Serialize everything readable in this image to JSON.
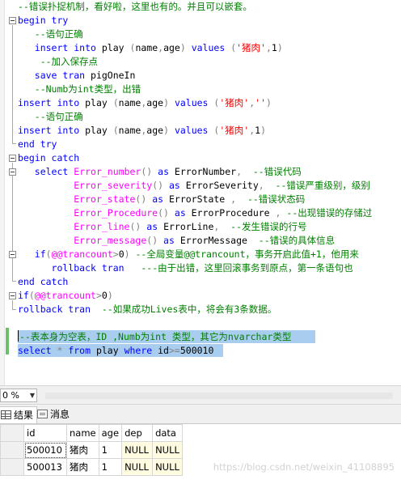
{
  "editor": {
    "lines": [
      [
        {
          "t": "--错误扑捉机制，看好啦，这里也有的。并且可以嵌套。",
          "c": "cm"
        }
      ],
      [
        {
          "t": "begin try",
          "c": "kw"
        }
      ],
      [
        {
          "t": "   --语句正确",
          "c": "cm"
        }
      ],
      [
        {
          "t": "   ",
          "c": ""
        },
        {
          "t": "insert into",
          "c": "kw"
        },
        {
          "t": " play ",
          "c": ""
        },
        {
          "t": "(",
          "c": "gy"
        },
        {
          "t": "name",
          "c": ""
        },
        {
          "t": ",",
          "c": "gy"
        },
        {
          "t": "age",
          "c": ""
        },
        {
          "t": ")",
          "c": "gy"
        },
        {
          "t": " values ",
          "c": "kw"
        },
        {
          "t": "(",
          "c": "gy"
        },
        {
          "t": "'猪肉'",
          "c": "st"
        },
        {
          "t": ",",
          "c": "gy"
        },
        {
          "t": "1",
          "c": ""
        },
        {
          "t": ")",
          "c": "gy"
        }
      ],
      [
        {
          "t": "    --加入保存点",
          "c": "cm"
        }
      ],
      [
        {
          "t": "   ",
          "c": ""
        },
        {
          "t": "save tran",
          "c": "kw"
        },
        {
          "t": " pigOneIn",
          "c": ""
        }
      ],
      [
        {
          "t": "   --Numb为int类型，出错",
          "c": "cm"
        }
      ],
      [
        {
          "t": "insert into",
          "c": "kw"
        },
        {
          "t": " play ",
          "c": ""
        },
        {
          "t": "(",
          "c": "gy"
        },
        {
          "t": "name",
          "c": ""
        },
        {
          "t": ",",
          "c": "gy"
        },
        {
          "t": "age",
          "c": ""
        },
        {
          "t": ")",
          "c": "gy"
        },
        {
          "t": " values ",
          "c": "kw"
        },
        {
          "t": "(",
          "c": "gy"
        },
        {
          "t": "'猪肉'",
          "c": "st"
        },
        {
          "t": ",",
          "c": "gy"
        },
        {
          "t": "''",
          "c": "st"
        },
        {
          "t": ")",
          "c": "gy"
        }
      ],
      [
        {
          "t": "   --语句正确",
          "c": "cm"
        }
      ],
      [
        {
          "t": "insert into",
          "c": "kw"
        },
        {
          "t": " play ",
          "c": ""
        },
        {
          "t": "(",
          "c": "gy"
        },
        {
          "t": "name",
          "c": ""
        },
        {
          "t": ",",
          "c": "gy"
        },
        {
          "t": "age",
          "c": ""
        },
        {
          "t": ")",
          "c": "gy"
        },
        {
          "t": " values ",
          "c": "kw"
        },
        {
          "t": "(",
          "c": "gy"
        },
        {
          "t": "'猪肉'",
          "c": "st"
        },
        {
          "t": ",",
          "c": "gy"
        },
        {
          "t": "1",
          "c": ""
        },
        {
          "t": ")",
          "c": "gy"
        }
      ],
      [
        {
          "t": "end try",
          "c": "kw"
        }
      ],
      [
        {
          "t": "begin catch",
          "c": "kw"
        }
      ],
      [
        {
          "t": "   ",
          "c": ""
        },
        {
          "t": "select",
          "c": "kw"
        },
        {
          "t": " ",
          "c": ""
        },
        {
          "t": "Error_number",
          "c": "fn"
        },
        {
          "t": "()",
          "c": "gy"
        },
        {
          "t": " as",
          "c": "kw"
        },
        {
          "t": " ErrorNumber",
          "c": ""
        },
        {
          "t": ",",
          "c": "gy"
        },
        {
          "t": "  --错误代码",
          "c": "cm"
        }
      ],
      [
        {
          "t": "          ",
          "c": ""
        },
        {
          "t": "Error_severity",
          "c": "fn"
        },
        {
          "t": "()",
          "c": "gy"
        },
        {
          "t": " as",
          "c": "kw"
        },
        {
          "t": " ErrorSeverity",
          "c": ""
        },
        {
          "t": ",",
          "c": "gy"
        },
        {
          "t": "  --错误严重级别，级别",
          "c": "cm"
        }
      ],
      [
        {
          "t": "          ",
          "c": ""
        },
        {
          "t": "Error_state",
          "c": "fn"
        },
        {
          "t": "()",
          "c": "gy"
        },
        {
          "t": " as",
          "c": "kw"
        },
        {
          "t": " ErrorState ",
          "c": ""
        },
        {
          "t": ",",
          "c": "gy"
        },
        {
          "t": "  --错误状态码",
          "c": "cm"
        }
      ],
      [
        {
          "t": "          ",
          "c": ""
        },
        {
          "t": "Error_Procedure",
          "c": "fn"
        },
        {
          "t": "()",
          "c": "gy"
        },
        {
          "t": " as",
          "c": "kw"
        },
        {
          "t": " ErrorProcedure ",
          "c": ""
        },
        {
          "t": ",",
          "c": "gy"
        },
        {
          "t": " --出现错误的存储过",
          "c": "cm"
        }
      ],
      [
        {
          "t": "          ",
          "c": ""
        },
        {
          "t": "Error_line",
          "c": "fn"
        },
        {
          "t": "()",
          "c": "gy"
        },
        {
          "t": " as",
          "c": "kw"
        },
        {
          "t": " ErrorLine",
          "c": ""
        },
        {
          "t": ",",
          "c": "gy"
        },
        {
          "t": "  --发生错误的行号",
          "c": "cm"
        }
      ],
      [
        {
          "t": "          ",
          "c": ""
        },
        {
          "t": "Error_message",
          "c": "fn"
        },
        {
          "t": "()",
          "c": "gy"
        },
        {
          "t": " as",
          "c": "kw"
        },
        {
          "t": " ErrorMessage  ",
          "c": ""
        },
        {
          "t": "--错误的具体信息",
          "c": "cm"
        }
      ],
      [
        {
          "t": "   ",
          "c": ""
        },
        {
          "t": "if",
          "c": "kw"
        },
        {
          "t": "(",
          "c": "gy"
        },
        {
          "t": "@@trancount",
          "c": "sv"
        },
        {
          "t": ">",
          "c": "gy"
        },
        {
          "t": "0",
          "c": ""
        },
        {
          "t": ")",
          "c": "gy"
        },
        {
          "t": " --全局变量@@trancount，事务开启此值+1，他用来",
          "c": "cm"
        }
      ],
      [
        {
          "t": "      ",
          "c": ""
        },
        {
          "t": "rollback tran",
          "c": "kw"
        },
        {
          "t": "   ",
          "c": ""
        },
        {
          "t": "---由于出错，这里回滚事务到原点，第一条语句也",
          "c": "cm"
        }
      ],
      [
        {
          "t": "end catch",
          "c": "kw"
        }
      ],
      [
        {
          "t": "if",
          "c": "kw"
        },
        {
          "t": "(",
          "c": "gy"
        },
        {
          "t": "@@trancount",
          "c": "sv"
        },
        {
          "t": ">",
          "c": "gy"
        },
        {
          "t": "0",
          "c": ""
        },
        {
          "t": ")",
          "c": "gy"
        }
      ],
      [
        {
          "t": "rollback tran",
          "c": "kw"
        },
        {
          "t": "  --如果成功Lives表中，将会有3条数据。",
          "c": "cm"
        }
      ],
      [
        {
          "t": "",
          "c": ""
        }
      ],
      [
        {
          "t": "--表本身为空表，ID ,Numb为int 类型，其它为nvarchar类型",
          "c": "cm"
        }
      ],
      [
        {
          "t": "select",
          "c": "kw"
        },
        {
          "t": " * ",
          "c": "gy"
        },
        {
          "t": "from",
          "c": "kw"
        },
        {
          "t": " play ",
          "c": ""
        },
        {
          "t": "where",
          "c": "kw"
        },
        {
          "t": " id",
          "c": ""
        },
        {
          "t": ">=",
          "c": "gy"
        },
        {
          "t": "500010",
          "c": ""
        }
      ]
    ]
  },
  "zoom": {
    "value": "0 %"
  },
  "tabs": {
    "results": "结果",
    "messages": "消息"
  },
  "results": {
    "columns": [
      "id",
      "name",
      "age",
      "dep",
      "data"
    ],
    "rows": [
      {
        "rownum": "",
        "cells": [
          "500010",
          "猪肉",
          "1",
          "NULL",
          "NULL"
        ]
      },
      {
        "rownum": "",
        "cells": [
          "500013",
          "猪肉",
          "1",
          "NULL",
          "NULL"
        ]
      }
    ]
  },
  "watermark": "https://blog.csdn.net/weixin_41108895",
  "colors": {
    "keyword": "#0000ff",
    "comment": "#008000",
    "string": "#ff0000",
    "function": "#ff00ff",
    "selection": "#a9cdee",
    "null_cell": "#fffbe0"
  }
}
